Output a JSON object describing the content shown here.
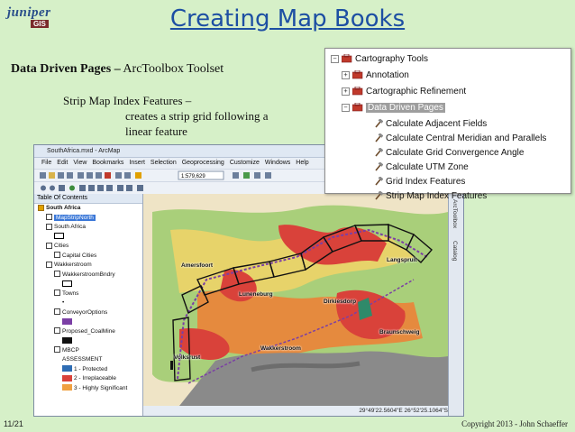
{
  "logo": {
    "wordmark": "juniper",
    "tag": "GIS"
  },
  "slide": {
    "title": "Creating Map Books",
    "heading_bold": "Data Driven Pages –",
    "heading_rest": " ArcToolbox Toolset",
    "sub_line1": "Strip Map Index Features –",
    "sub_line2": "creates a strip grid following a",
    "sub_line3": "linear feature",
    "page_number": "11/21",
    "copyright": "Copyright 2013 - John Schaeffer"
  },
  "toolbox": {
    "root": "Cartography Tools",
    "groups": [
      {
        "label": "Annotation",
        "expander": "+"
      },
      {
        "label": "Cartographic Refinement",
        "expander": "+"
      },
      {
        "label": "Data Driven Pages",
        "expander": "−",
        "selected": true
      }
    ],
    "tools": [
      "Calculate Adjacent Fields",
      "Calculate Central Meridian and Parallels",
      "Calculate Grid Convergence Angle",
      "Calculate UTM Zone",
      "Grid Index Features",
      "Strip Map Index Features"
    ]
  },
  "arcmap": {
    "window_title": "SouthAfrica.mxd - ArcMap",
    "menu": [
      "File",
      "Edit",
      "View",
      "Bookmarks",
      "Insert",
      "Selection",
      "Geoprocessing",
      "Customize",
      "Windows",
      "Help"
    ],
    "scale": "1:579,629",
    "toc_title": "Table Of Contents",
    "toc": [
      {
        "text": "South Africa",
        "indent": 0,
        "kind": "frame"
      },
      {
        "text": "MapStripNorth",
        "indent": 1,
        "kind": "layer",
        "selected": true
      },
      {
        "text": "South Africa",
        "indent": 1,
        "kind": "layer"
      },
      {
        "text": "",
        "indent": 2,
        "kind": "swatch-outline"
      },
      {
        "text": "Cities",
        "indent": 1,
        "kind": "layer"
      },
      {
        "text": "Capital Cities",
        "indent": 2,
        "kind": "layer"
      },
      {
        "text": "Wakkerstroom",
        "indent": 1,
        "kind": "layer"
      },
      {
        "text": "WakkerstroomBndry",
        "indent": 2,
        "kind": "layer"
      },
      {
        "text": "",
        "indent": 3,
        "kind": "swatch-outline"
      },
      {
        "text": "Towns",
        "indent": 2,
        "kind": "layer"
      },
      {
        "text": "•",
        "indent": 3,
        "kind": "text"
      },
      {
        "text": "ConveyorOptions",
        "indent": 2,
        "kind": "layer"
      },
      {
        "text": "",
        "indent": 3,
        "kind": "swatch-purple"
      },
      {
        "text": "Proposed_CoalMine",
        "indent": 2,
        "kind": "layer"
      },
      {
        "text": "",
        "indent": 3,
        "kind": "swatch-black"
      },
      {
        "text": "MBCP",
        "indent": 2,
        "kind": "layer"
      },
      {
        "text": "ASSESSMENT",
        "indent": 3,
        "kind": "text"
      },
      {
        "text": "1 - Protected",
        "indent": 3,
        "kind": "swatch-blue"
      },
      {
        "text": "2 - Irreplaceable",
        "indent": 3,
        "kind": "swatch-red"
      },
      {
        "text": "3 - Highly Significant",
        "indent": 3,
        "kind": "swatch-orange"
      }
    ],
    "map_labels": [
      "Amersfoort",
      "Langspruit",
      "Dirkiesdorp",
      "Luneneburg",
      "Wakkerstroom",
      "Braunschweig",
      "Volksrust"
    ],
    "coordinates": "29°49'22.5604\"E  26°52'25.1064\"S",
    "side_tabs": [
      "ArcToolbox",
      "Catalog"
    ]
  },
  "colors": {
    "title": "#1d4fa3",
    "background": "#d6f0c8",
    "highlight": "#9e9e9e"
  }
}
